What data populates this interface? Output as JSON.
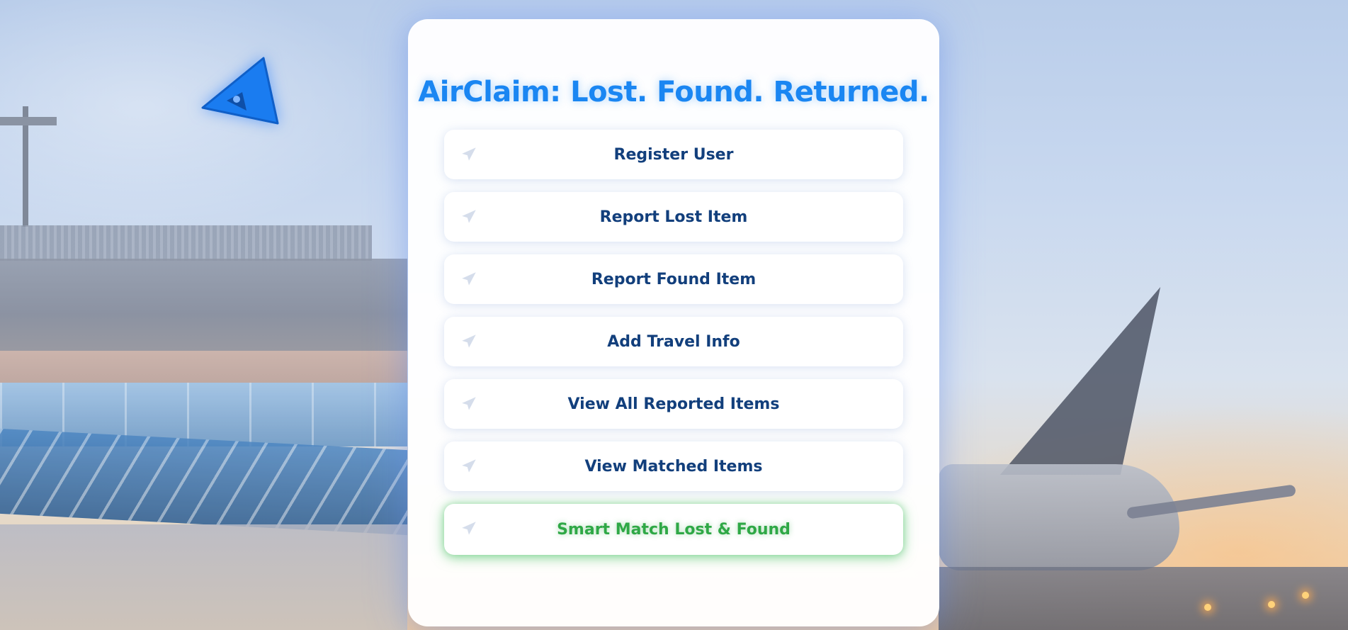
{
  "app": {
    "title": "AirClaim: Lost. Found. Returned."
  },
  "menu": {
    "items": [
      {
        "label": "Register User"
      },
      {
        "label": "Report Lost Item"
      },
      {
        "label": "Report Found Item"
      },
      {
        "label": "Add Travel Info"
      },
      {
        "label": "View All Reported Items"
      },
      {
        "label": "View Matched Items"
      },
      {
        "label": "Smart Match Lost & Found"
      }
    ]
  },
  "icons": {
    "logo": "airplane-logo-icon",
    "menu_item": "airplane-icon"
  },
  "colors": {
    "title": "#1a86f2",
    "button_text": "#123f7c",
    "smart_match_text": "#2fa846",
    "logo": "#1a7cf0"
  }
}
